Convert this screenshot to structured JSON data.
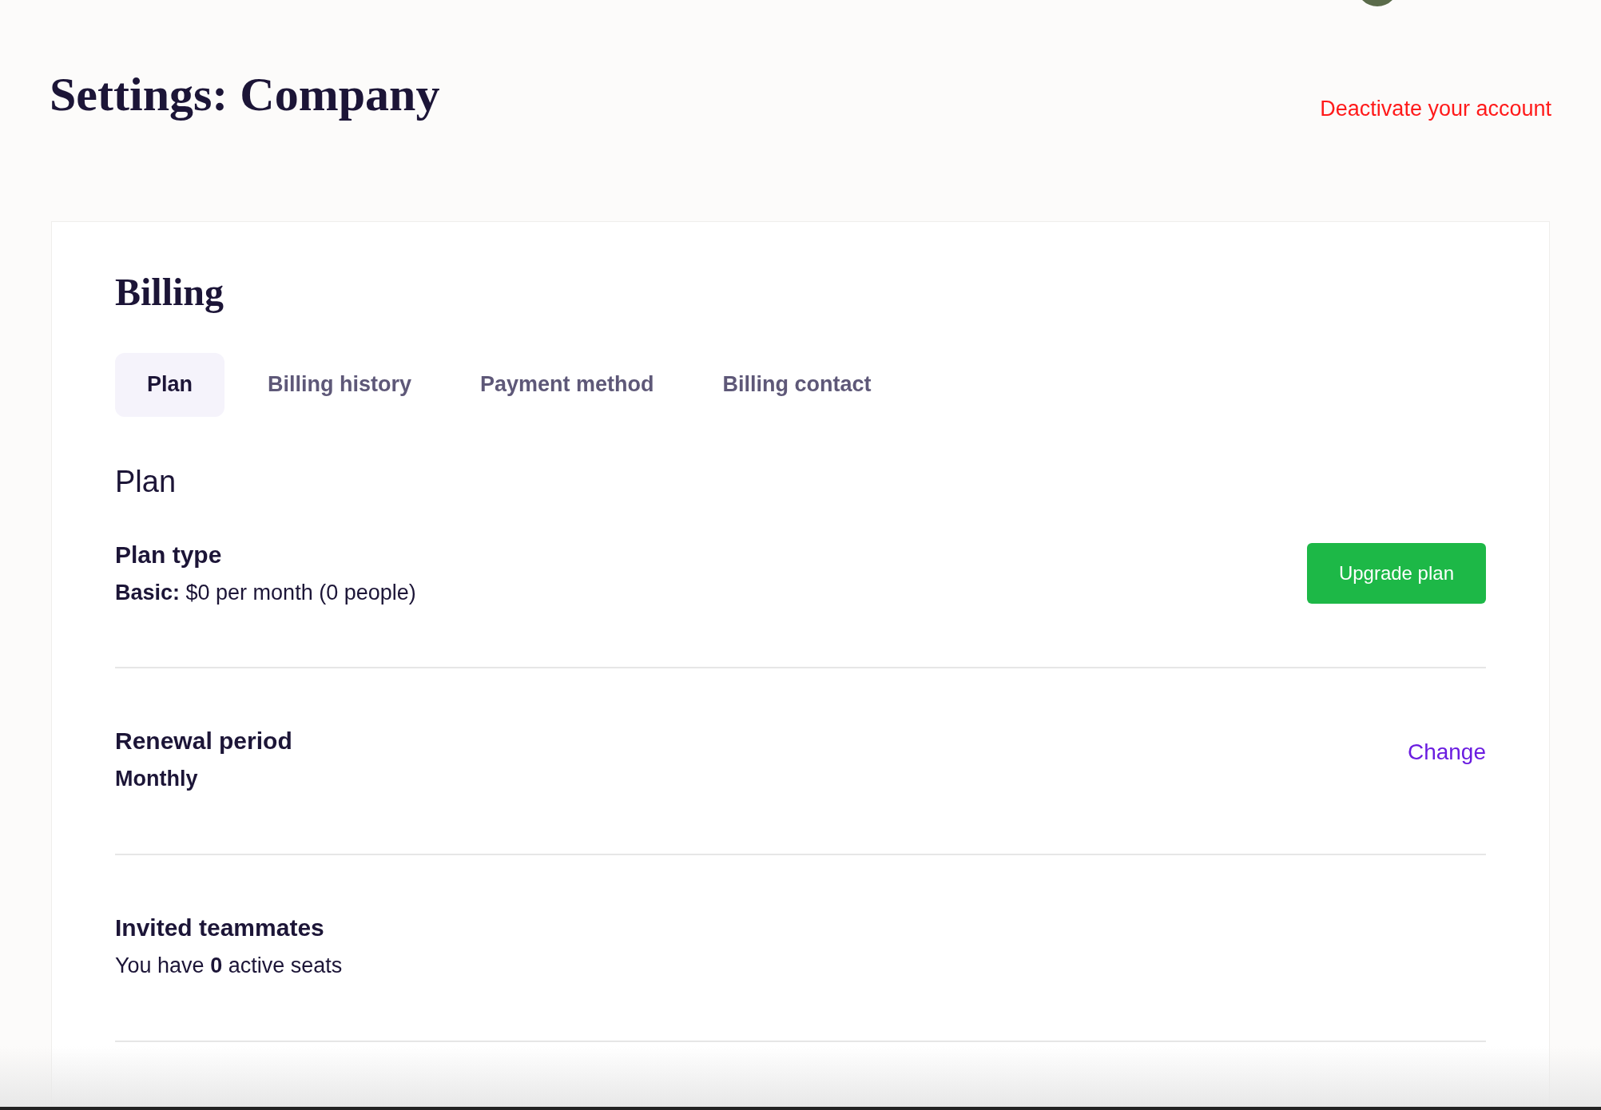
{
  "page": {
    "title": "Settings: Company",
    "deactivate_link": "Deactivate your account"
  },
  "billing": {
    "heading": "Billing",
    "tabs": [
      {
        "label": "Plan",
        "selected": true
      },
      {
        "label": "Billing history",
        "selected": false
      },
      {
        "label": "Payment method",
        "selected": false
      },
      {
        "label": "Billing contact",
        "selected": false
      }
    ],
    "section_title": "Plan",
    "rows": [
      {
        "label": "Plan type",
        "value": "**Basic:** $0 per month (0 people)",
        "value_bold": false,
        "action": {
          "kind": "button",
          "label": "Upgrade plan"
        }
      },
      {
        "label": "Renewal period",
        "value": "Monthly",
        "value_bold": true,
        "action": {
          "kind": "link",
          "label": "Change"
        }
      },
      {
        "label": "Invited teammates",
        "value": "You have **0** active seats",
        "value_bold": false
      }
    ]
  }
}
